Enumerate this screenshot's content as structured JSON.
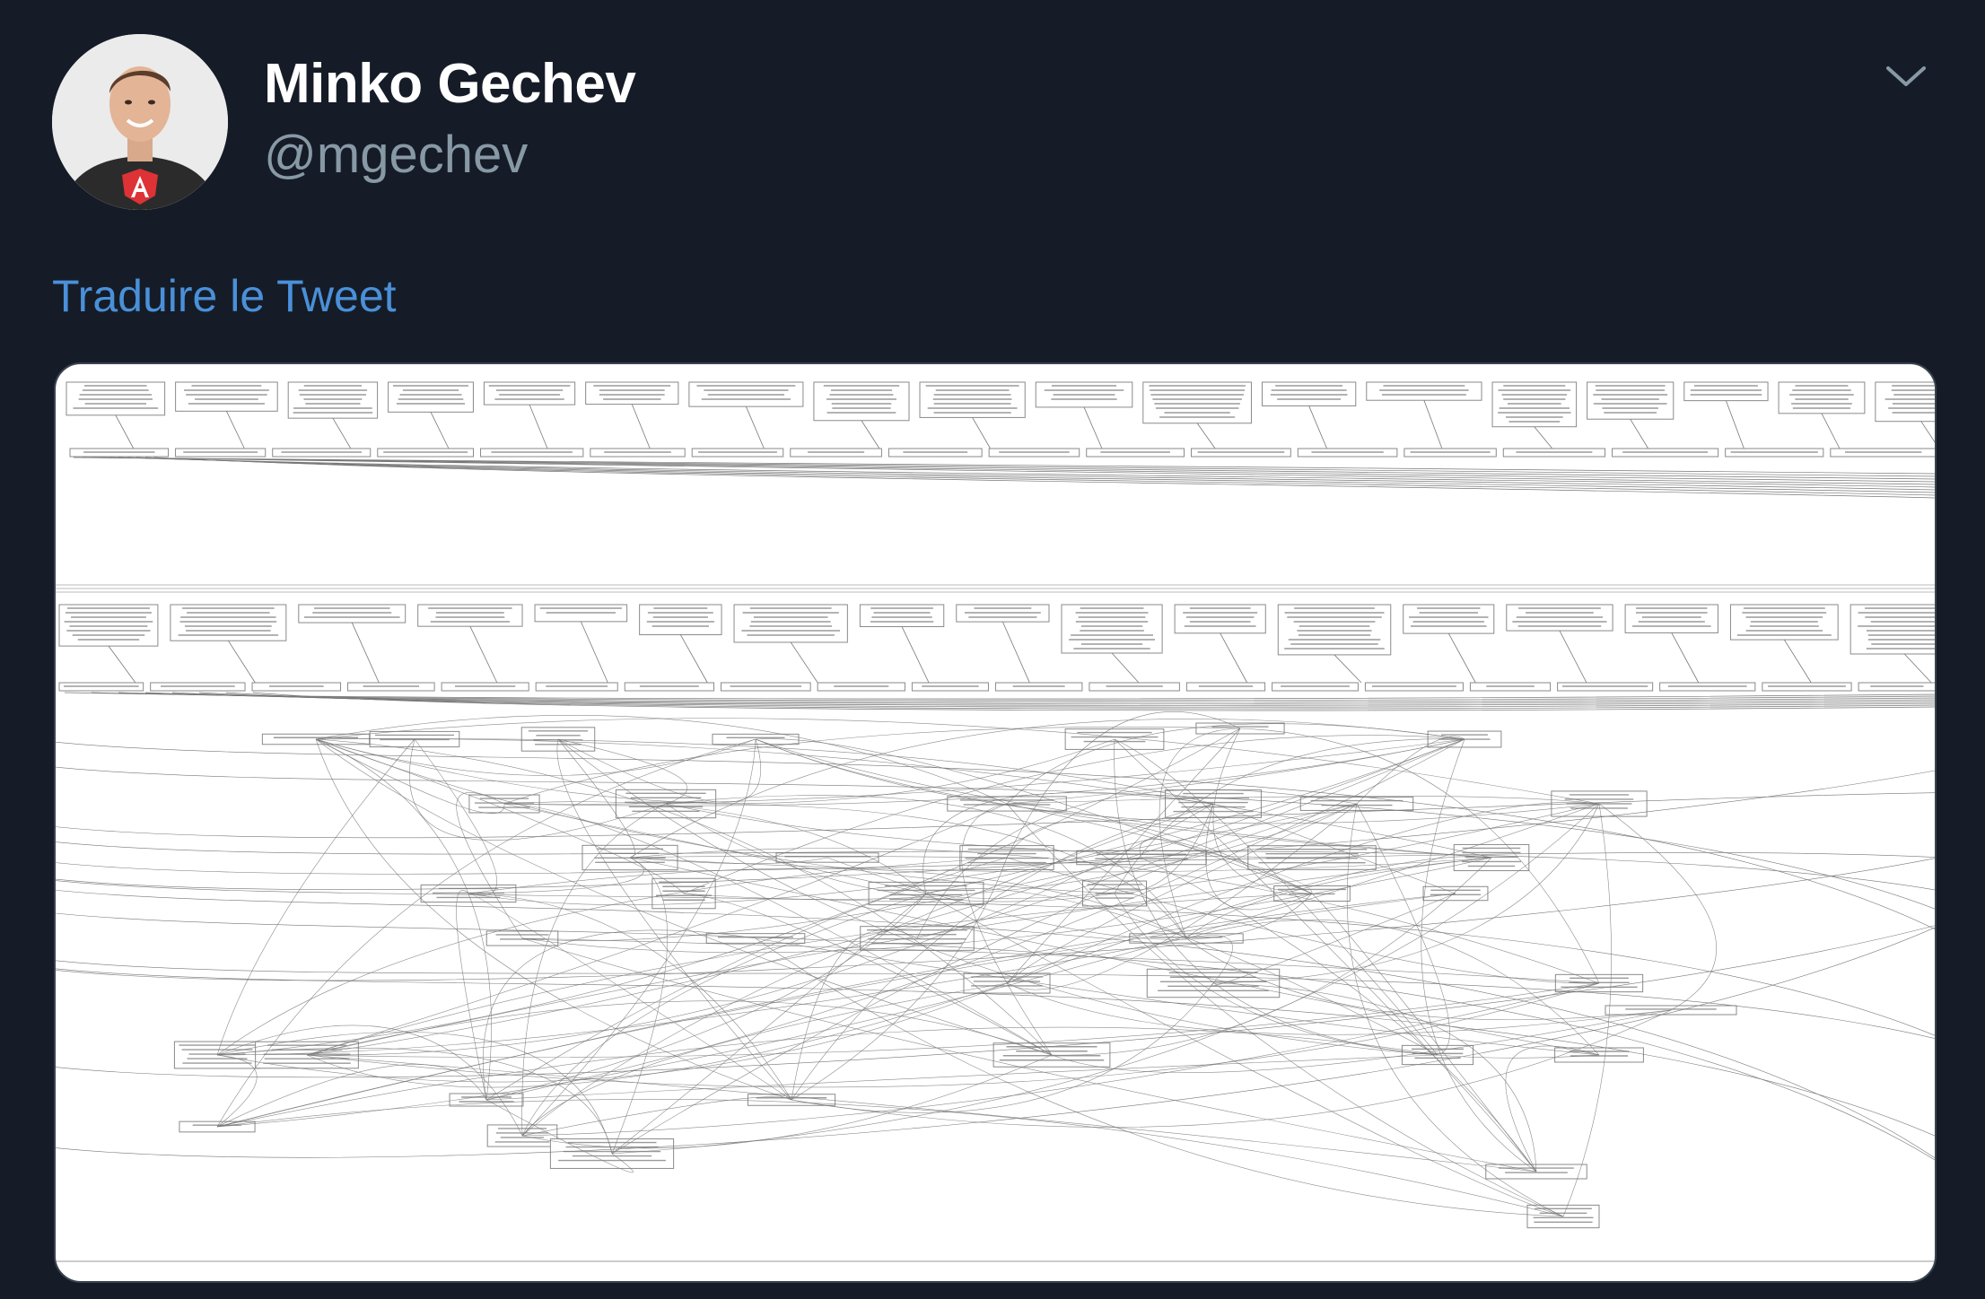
{
  "tweet": {
    "author": {
      "display_name": "Minko Gechev",
      "handle": "@mgechev",
      "avatar_icon": "profile-photo"
    },
    "menu_icon": "chevron-down-icon",
    "translate_link": "Traduire le Tweet",
    "media": {
      "type": "image",
      "description_icon": "dependency-graph-image"
    }
  },
  "colors": {
    "background": "#151c27",
    "text_primary": "#ffffff",
    "text_secondary": "#8899a6",
    "link": "#4a90d9"
  }
}
